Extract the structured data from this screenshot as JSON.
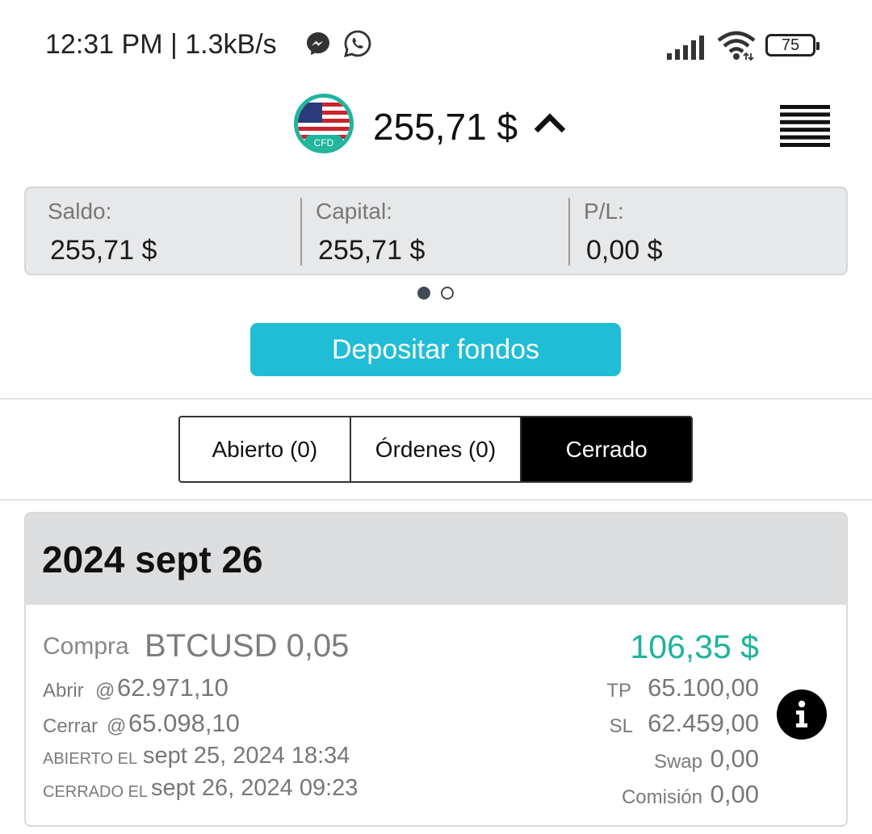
{
  "status_bar": {
    "time_text": "12:31 PM | 1.3kB/s",
    "battery": "75",
    "icons": [
      "messenger-icon",
      "whatsapp-icon",
      "signal-icon",
      "wifi-icon",
      "battery-icon"
    ]
  },
  "header": {
    "balance": "255,71 $",
    "flag_badge": "CFD"
  },
  "summary": {
    "saldo_label": "Saldo:",
    "saldo_value": "255,71 $",
    "capital_label": "Capital:",
    "capital_value": "255,71 $",
    "pl_label": "P/L:",
    "pl_value": "0,00 $"
  },
  "pager": {
    "current": 1,
    "total": 2
  },
  "deposit_button": "Depositar fondos",
  "tabs": [
    {
      "label": "Abierto (0)",
      "active": false
    },
    {
      "label": "Órdenes (0)",
      "active": false
    },
    {
      "label": "Cerrado",
      "active": true
    }
  ],
  "trade": {
    "date_header": "2024 sept 26",
    "type": "Compra",
    "symbol_qty": "BTCUSD 0,05",
    "open_label": "Abrir",
    "open_value": "62.971,10",
    "close_label": "Cerrar",
    "close_value": "65.098,10",
    "at_sign": "@",
    "opened_label": "ABIERTO EL",
    "opened_value": "sept 25, 2024 18:34",
    "closed_label": "CERRADO EL",
    "closed_value": "sept 26, 2024 09:23",
    "pnl": "106,35 $",
    "tp_label": "TP",
    "tp_value": "65.100,00",
    "sl_label": "SL",
    "sl_value": "62.459,00",
    "swap_label": "Swap",
    "swap_value": "0,00",
    "commission_label": "Comisión",
    "commission_value": "0,00"
  },
  "colors": {
    "accent": "#21bdd6",
    "profit": "#1db39b",
    "flag_ring": "#1fb59c"
  }
}
